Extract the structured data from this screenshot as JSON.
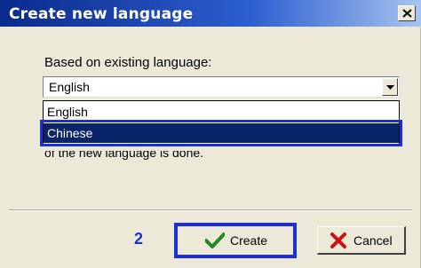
{
  "window": {
    "title": "Create new language",
    "close_glyph": "x"
  },
  "form": {
    "based_on_label": "Based on existing language:",
    "selected_value": "English",
    "dropdown_options": [
      "English",
      "Chinese"
    ],
    "highlighted_option": "Chinese",
    "partially_hidden_text": "of the new language is done."
  },
  "annotation": {
    "step_number": "2",
    "highlight_color": "#1a2fe0"
  },
  "buttons": {
    "create_label": "Create",
    "cancel_label": "Cancel",
    "create_icon": "checkmark-icon",
    "cancel_icon": "x-icon"
  },
  "colors": {
    "title_bar": "#0a2a8c",
    "selection": "#0a246a",
    "dialog_bg": "#ece9d8"
  }
}
